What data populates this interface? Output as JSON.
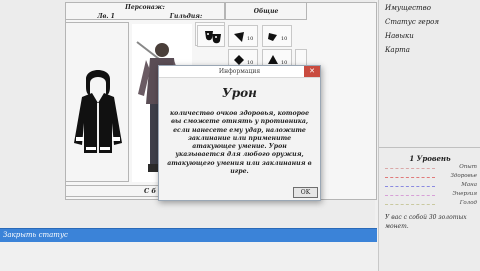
{
  "character": {
    "name_label": "Персонаж:",
    "level_label": "Лв. 1",
    "guild_label": "Гильдия:",
    "general_label": "Общие",
    "stats": [
      {
        "icon": "mask-icon",
        "value": ""
      },
      {
        "icon": "theater-masks-icon",
        "value": ""
      },
      {
        "icon": "skill-icon-a",
        "value": "10"
      },
      {
        "icon": "skill-icon-b",
        "value": "10"
      },
      {
        "icon": "skill-icon-c",
        "value": "10"
      },
      {
        "icon": "skill-icon-d",
        "value": "10"
      }
    ],
    "bottom_label": "С б"
  },
  "menu": {
    "items": [
      "Имущество",
      "Статус героя",
      "Навыки",
      "Карта"
    ]
  },
  "level_panel": {
    "title": "1 Уровень",
    "stats": [
      {
        "label": "Опыт",
        "color": "#d9a8a8"
      },
      {
        "label": "Здоровье",
        "color": "#e07a7a"
      },
      {
        "label": "Мана",
        "color": "#8a8ae0"
      },
      {
        "label": "Энергия",
        "color": "#d7a0d7"
      },
      {
        "label": "Голод",
        "color": "#c9c9a0"
      }
    ],
    "gold_text": "У вас с собой 30 золотых монет."
  },
  "status_bar": {
    "text": "Закрыть статус"
  },
  "dialog": {
    "title": "Информация",
    "close": "✕",
    "heading": "Урон",
    "body": "количество очков здоровья, которое вы сможете отнять у противника, если нанесете ему удар, наложите заклинание или примените атакующее умение. Урон указывается для любого оружия, атакующего умения или заклинания в игре.",
    "ok_label": "OK"
  }
}
